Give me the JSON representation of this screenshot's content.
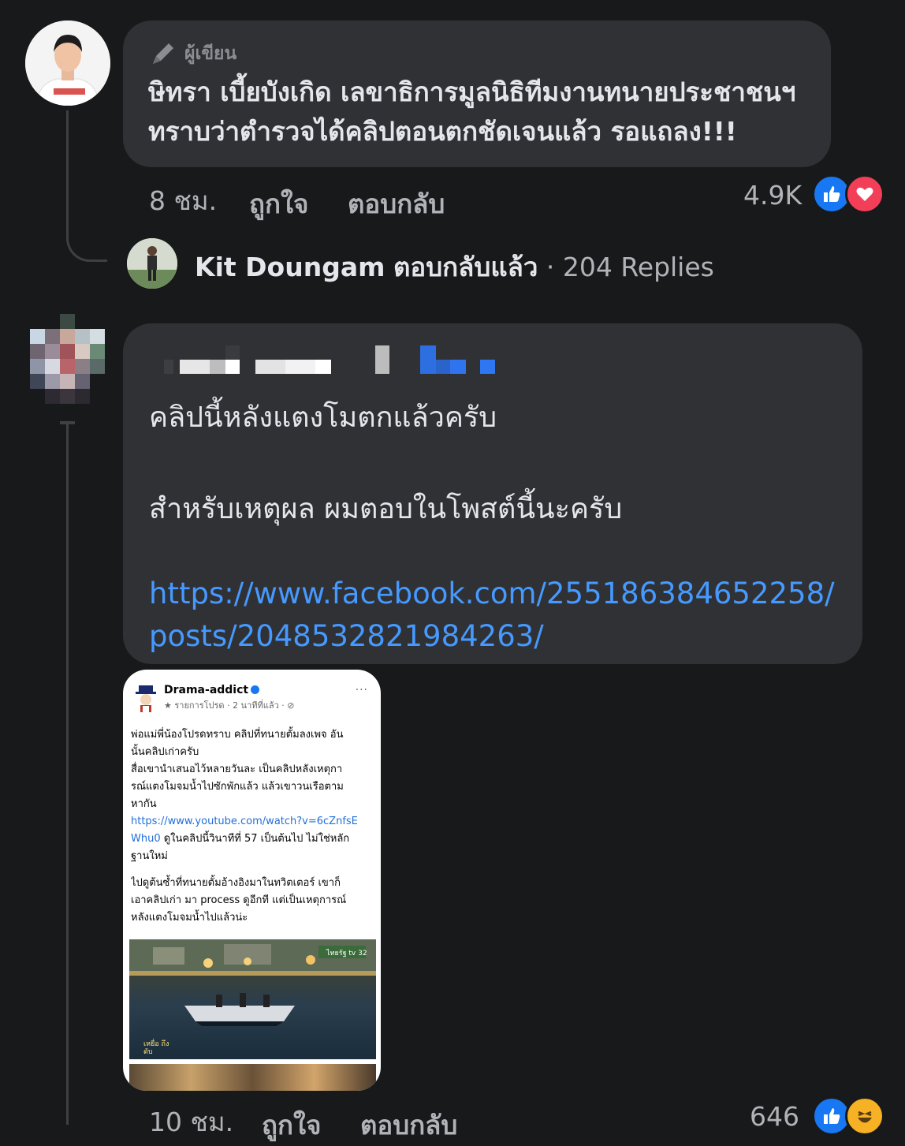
{
  "comment1": {
    "badge_label": "ผู้เขียน",
    "badge_icon": "pen-icon",
    "lines": [
      "ษิทรา เบี้ยบังเกิด เลขาธิการมูลนิธิทีมงานทนายประชาชนฯ",
      "ทราบว่าตำรวจได้คลิปตอนตกชัดเจนแล้ว รอแถลง!!!"
    ],
    "time": "8 ชม.",
    "like_label": "ถูกใจ",
    "reply_label": "ตอบกลับ",
    "reaction_count": "4.9K",
    "reactions": [
      "like-icon",
      "love-icon"
    ]
  },
  "reply_summary": {
    "name": "Kit Doungam",
    "action": "ตอบกลับแล้ว",
    "count": "· 204 Replies"
  },
  "comment2": {
    "line1": "คลิปนี้หลังแตงโมตกแล้วครับ",
    "line2": "สำหรับเหตุผล ผมตอบในโพสต์นี้นะครับ",
    "link_part1": "https://www.facebook.com/255186384652258/",
    "link_part2": "posts/2048532821984263/",
    "time": "10 ชม.",
    "like_label": "ถูกใจ",
    "reply_label": "ตอบกลับ",
    "reaction_count": "646",
    "reactions": [
      "like-icon",
      "haha-icon"
    ]
  },
  "attachment": {
    "page_name": "Drama-addict",
    "sub": "★ รายการโปรด · 2 นาทีที่แล้ว · ⊘",
    "more": "···",
    "lines": [
      "พ่อแม่พี่น้องโปรดทราบ คลิปที่ทนายตั้มลงเพจ อัน",
      "นั้นคลิปเก่าครับ",
      "สื่อเขานำเสนอไว้หลายวันละ เป็นคลิปหลังเหตุกา",
      "รณ์แตงโมจมน้ำไปซักพักแล้ว แล้วเขาวนเรือตาม",
      "หากัน"
    ],
    "link1": "https://www.youtube.com/watch?v=6cZnfsE",
    "link2": "Whu0",
    "after_link": " ดูในคลิปนี้วินาทีที่ 57 เป็นต้นไป ไม่ใช่หลัก",
    "line_after": "ฐานใหม่",
    "para2": [
      "ไปดูต้นซ้ำที่ทนายตั้มอ้างอิงมาในทวิตเตอร์ เขาก็",
      "เอาคลิปเก่า มา process ดูอีกที แต่เป็นเหตุการณ์",
      "หลังแตงโมจมน้ำไปแล้วน่ะ"
    ],
    "photo_tag": "ไทยรัฐ tv 32",
    "photo_caption": "เหยื่อ ถึงดับ"
  }
}
